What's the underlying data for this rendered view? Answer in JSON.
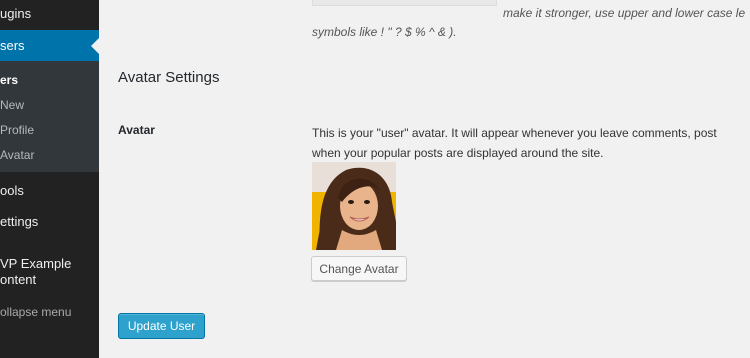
{
  "sidebar": {
    "top_item": "ugins",
    "active_item": "sers",
    "submenu": [
      "ers",
      "New",
      "Profile",
      "Avatar"
    ],
    "items": [
      "ools",
      "ettings",
      "VP Example",
      "ontent"
    ],
    "collapse": "ollapse menu"
  },
  "password": {
    "hint_line1": "make it stronger, use upper and lower case le",
    "hint_line2": "symbols like ! \" ? $ % ^ & )."
  },
  "avatar_settings": {
    "title": "Avatar Settings",
    "label": "Avatar",
    "desc_line1": "This is your \"user\" avatar. It will appear whenever you leave comments, post",
    "desc_line2": "when your popular posts are displayed around the site.",
    "change_button": "Change Avatar"
  },
  "update_button": "Update User",
  "colors": {
    "sidebar_bg": "#222222",
    "submenu_bg": "#32373c",
    "active_bg": "#0073aa",
    "primary_button": "#2ea2cc",
    "page_bg": "#f1f1f1"
  }
}
